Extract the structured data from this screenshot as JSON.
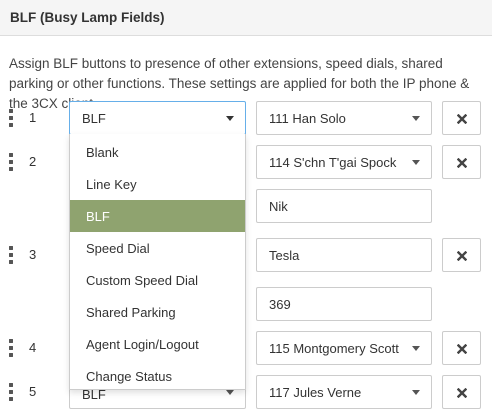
{
  "panel": {
    "title": "BLF (Busy Lamp Fields)",
    "description": "Assign BLF buttons to presence of other extensions, speed dials, shared parking or other functions. These settings are applied for both the IP phone & the 3CX client."
  },
  "rows": [
    {
      "number": "1",
      "type": "BLF",
      "value": "111 Han Solo"
    },
    {
      "number": "2",
      "value": "114 S'chn T'gai Spock",
      "extra": "Nik"
    },
    {
      "number": "3",
      "value": "Tesla",
      "extra": "369"
    },
    {
      "number": "4",
      "value": "115 Montgomery Scott"
    },
    {
      "number": "5",
      "type": "BLF",
      "value": "117 Jules Verne"
    }
  ],
  "dropdown": {
    "options": [
      "Blank",
      "Line Key",
      "BLF",
      "Speed Dial",
      "Custom Speed Dial",
      "Shared Parking",
      "Agent Login/Logout",
      "Change Status"
    ],
    "selected": "BLF"
  },
  "colors": {
    "selected_option_bg": "#8fa36f",
    "focus_border": "#66afe9"
  },
  "icons": {
    "drag": "drag-handle-icon",
    "caret": "caret-down-icon",
    "delete": "close-icon"
  }
}
